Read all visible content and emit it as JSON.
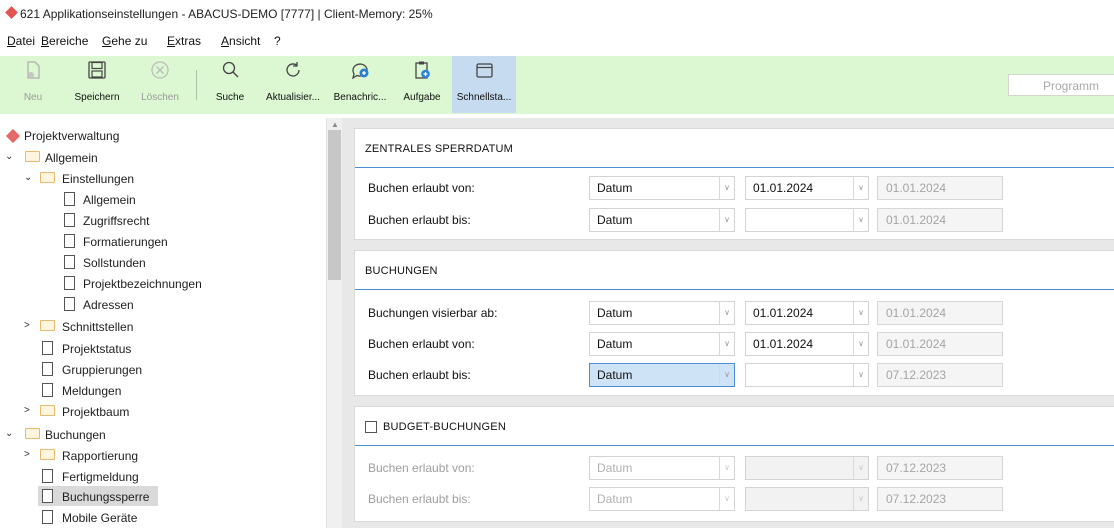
{
  "window": {
    "title": "621 Applikationseinstellungen - ABACUS-DEMO [7777] | Client-Memory: 25%"
  },
  "menu": [
    "Datei",
    "Bereiche",
    "Gehe zu",
    "Extras",
    "Ansicht",
    "?"
  ],
  "toolbar": {
    "buttons": [
      {
        "label": "Neu",
        "icon": "new-doc-icon",
        "enabled": false
      },
      {
        "label": "Speichern",
        "icon": "save-icon",
        "enabled": true
      },
      {
        "label": "Löschen",
        "icon": "delete-icon",
        "enabled": false
      },
      {
        "label": "Suche",
        "icon": "search-icon",
        "enabled": true
      },
      {
        "label": "Aktualisier...",
        "icon": "refresh-icon",
        "enabled": true
      },
      {
        "label": "Benachric...",
        "icon": "notification-icon",
        "enabled": true
      },
      {
        "label": "Aufgabe",
        "icon": "task-icon",
        "enabled": true
      },
      {
        "label": "Schnellsta...",
        "icon": "quickstart-icon",
        "enabled": true,
        "active": true
      }
    ],
    "program_search_placeholder": "Programm"
  },
  "tree": [
    {
      "label": "Projektverwaltung",
      "icon": "module-icon"
    },
    {
      "label": "Allgemein",
      "icon": "folder-icon",
      "chevron": "expanded"
    },
    {
      "label": "Einstellungen",
      "icon": "folder-icon",
      "chevron": "expanded"
    },
    {
      "label": "Allgemein",
      "icon": "page-icon"
    },
    {
      "label": "Zugriffsrecht",
      "icon": "page-icon"
    },
    {
      "label": "Formatierungen",
      "icon": "page-icon"
    },
    {
      "label": "Sollstunden",
      "icon": "page-icon"
    },
    {
      "label": "Projektbezeichnungen",
      "icon": "page-icon"
    },
    {
      "label": "Adressen",
      "icon": "page-icon"
    },
    {
      "label": "Schnittstellen",
      "icon": "folder-icon",
      "chevron": "collapsed"
    },
    {
      "label": "Projektstatus",
      "icon": "page-icon"
    },
    {
      "label": "Gruppierungen",
      "icon": "page-icon"
    },
    {
      "label": "Meldungen",
      "icon": "page-icon"
    },
    {
      "label": "Projektbaum",
      "icon": "folder-icon",
      "chevron": "collapsed"
    },
    {
      "label": "Buchungen",
      "icon": "folder-icon",
      "chevron": "expanded"
    },
    {
      "label": "Rapportierung",
      "icon": "folder-icon",
      "chevron": "collapsed"
    },
    {
      "label": "Fertigmeldung",
      "icon": "page-icon"
    },
    {
      "label": "Buchungssperre",
      "icon": "page-icon",
      "selected": true
    },
    {
      "label": "Mobile Geräte",
      "icon": "page-icon"
    }
  ],
  "sections": {
    "zentrales": {
      "heading": "ZENTRALES SPERRDATUM",
      "rows": [
        {
          "label": "Buchen erlaubt von:",
          "type": "Datum",
          "date": "01.01.2024",
          "readonly": "01.01.2024"
        },
        {
          "label": "Buchen erlaubt bis:",
          "type": "Datum",
          "date": "",
          "readonly": "01.01.2024"
        }
      ]
    },
    "buchungen": {
      "heading": "BUCHUNGEN",
      "rows": [
        {
          "label": "Buchungen visierbar ab:",
          "type": "Datum",
          "date": "01.01.2024",
          "readonly": "01.01.2024"
        },
        {
          "label": "Buchen erlaubt von:",
          "type": "Datum",
          "date": "01.01.2024",
          "readonly": "01.01.2024"
        },
        {
          "label": "Buchen erlaubt bis:",
          "type": "Datum",
          "date": "",
          "readonly": "07.12.2023"
        }
      ]
    },
    "budget": {
      "heading": "BUDGET-BUCHUNGEN",
      "checked": false,
      "rows": [
        {
          "label": "Buchen erlaubt von:",
          "type": "Datum",
          "date": "",
          "readonly": "07.12.2023"
        },
        {
          "label": "Buchen erlaubt bis:",
          "type": "Datum",
          "date": "",
          "readonly": "07.12.2023"
        }
      ]
    }
  },
  "colors": {
    "toolbar_bg": "#dcf8d2",
    "accent_line": "#4a8fd6",
    "focused_field": "#cfe3f7",
    "title_icon": "#e25550"
  }
}
